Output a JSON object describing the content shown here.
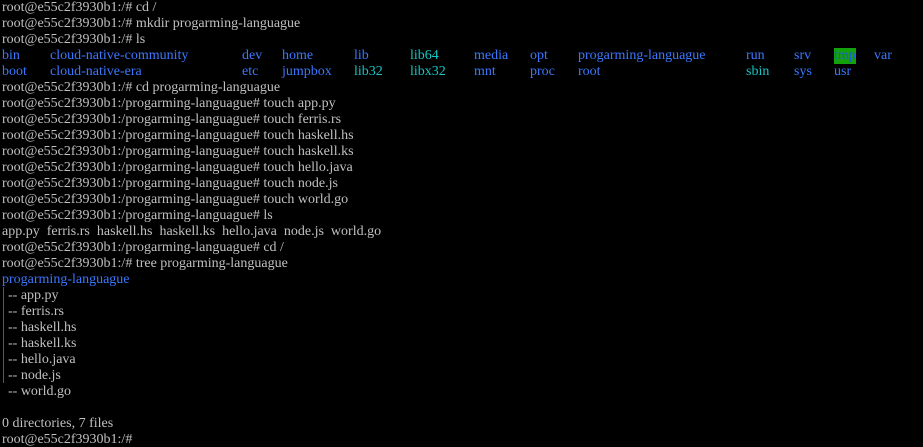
{
  "terminal": {
    "lines": [
      "root@e55c2f3930b1:/# cd /",
      "root@e55c2f3930b1:/# mkdir progarming-languague",
      "root@e55c2f3930b1:/# ls",
      "",
      "",
      "root@e55c2f3930b1:/# cd progarming-languague",
      "root@e55c2f3930b1:/progarming-languague# touch app.py",
      "root@e55c2f3930b1:/progarming-languague# touch ferris.rs",
      "root@e55c2f3930b1:/progarming-languague# touch haskell.hs",
      "root@e55c2f3930b1:/progarming-languague# touch haskell.ks",
      "root@e55c2f3930b1:/progarming-languague# touch hello.java",
      "root@e55c2f3930b1:/progarming-languague# touch node.js",
      "root@e55c2f3930b1:/progarming-languague# touch world.go",
      "root@e55c2f3930b1:/progarming-languague# ls",
      "app.py  ferris.rs  haskell.hs  haskell.ks  hello.java  node.js  world.go",
      "root@e55c2f3930b1:/progarming-languague# cd /",
      "root@e55c2f3930b1:/# tree progarming-languague",
      "progarming-languague",
      "-- app.py",
      "-- ferris.rs",
      "-- haskell.hs",
      "-- haskell.ks",
      "-- hello.java",
      "-- node.js",
      "-- world.go",
      "",
      "0 directories, 7 files",
      "root@e55c2f3930b1:/#"
    ],
    "ls_row1": [
      "bin",
      "cloud-native-community",
      "dev",
      "home",
      "lib",
      "lib64",
      "media",
      "opt",
      "progarming-languague",
      "run",
      "srv",
      "tmp",
      "var"
    ],
    "ls_row2": [
      "boot",
      "cloud-native-era",
      "etc",
      "jumpbox",
      "lib32",
      "libx32",
      "mnt",
      "proc",
      "root",
      "sbin",
      "sys",
      "usr"
    ],
    "colors": {
      "background": "#000000",
      "foreground": "#c0c0c0",
      "directory": "#3b78ff",
      "symlink": "#16c6c6",
      "sticky_bg": "#13a10e"
    }
  }
}
